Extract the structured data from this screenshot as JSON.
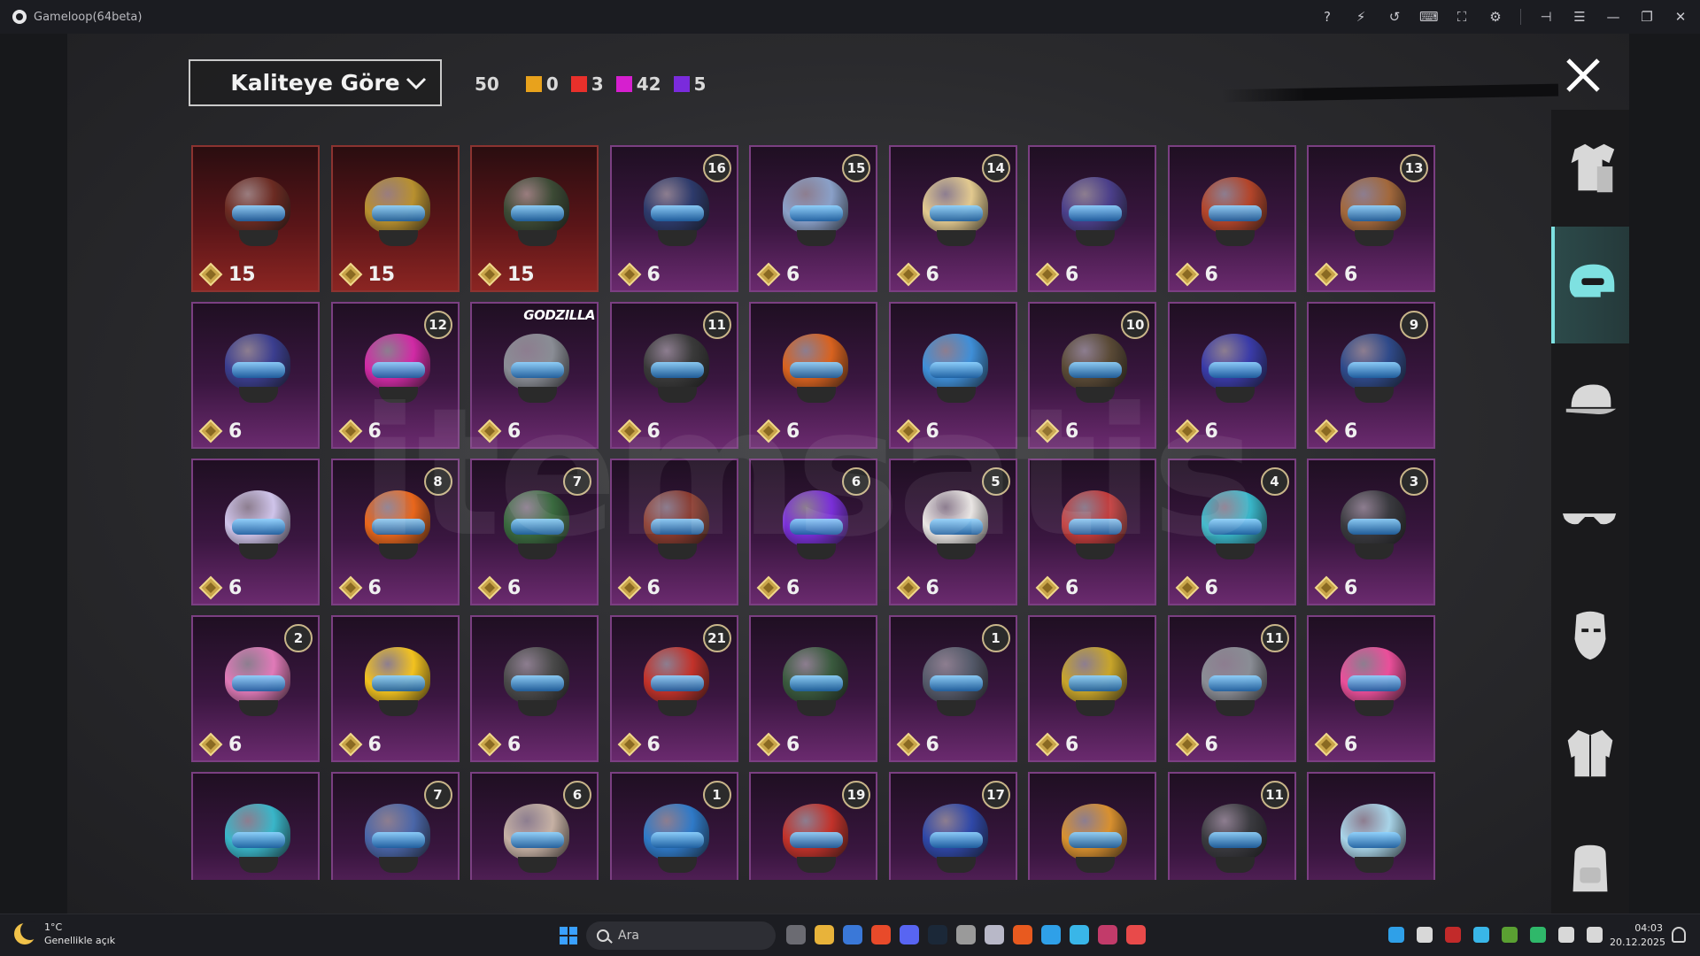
{
  "titlebar": {
    "title": "Gameloop(64beta)",
    "icons": [
      "help-icon",
      "bolt-icon",
      "undo-icon",
      "keyboard-icon",
      "fullscreen-icon",
      "settings-icon",
      "pin-icon",
      "menu-icon",
      "minimize-icon",
      "restore-icon",
      "close-icon"
    ]
  },
  "toolbar": {
    "sort_label": "Kaliteye Göre",
    "total": "50",
    "counts": [
      {
        "color": "#e8a21c",
        "value": "0"
      },
      {
        "color": "#e8302b",
        "value": "3"
      },
      {
        "color": "#d61fcf",
        "value": "42"
      },
      {
        "color": "#7a2bdc",
        "value": "5"
      }
    ]
  },
  "watermark": "itemsatis",
  "items": [
    {
      "price": "15",
      "badge": "",
      "rarity": "red",
      "color": "#6b2b22"
    },
    {
      "price": "15",
      "badge": "",
      "rarity": "red",
      "color": "#b8902f"
    },
    {
      "price": "15",
      "badge": "",
      "rarity": "red",
      "color": "#3c4a35"
    },
    {
      "price": "6",
      "badge": "16",
      "rarity": "purple",
      "color": "#2d3a6b"
    },
    {
      "price": "6",
      "badge": "15",
      "rarity": "purple",
      "color": "#8aa0c8"
    },
    {
      "price": "6",
      "badge": "14",
      "rarity": "purple",
      "color": "#e2c98f"
    },
    {
      "price": "6",
      "badge": "",
      "rarity": "purple",
      "color": "#4b3f8a"
    },
    {
      "price": "6",
      "badge": "",
      "rarity": "purple",
      "color": "#b3452a"
    },
    {
      "price": "6",
      "badge": "13",
      "rarity": "purple",
      "color": "#a2683c"
    },
    {
      "price": "6",
      "badge": "",
      "rarity": "purple",
      "color": "#3b3e8f"
    },
    {
      "price": "6",
      "badge": "12",
      "rarity": "purple",
      "color": "#d12aa5"
    },
    {
      "price": "6",
      "badge": "",
      "rarity": "purple",
      "color": "#8a8d95",
      "tag": "GODZILLA"
    },
    {
      "price": "6",
      "badge": "11",
      "rarity": "purple",
      "color": "#3a3a3a"
    },
    {
      "price": "6",
      "badge": "",
      "rarity": "purple",
      "color": "#d8621f"
    },
    {
      "price": "6",
      "badge": "",
      "rarity": "purple",
      "color": "#3f8fd8"
    },
    {
      "price": "6",
      "badge": "10",
      "rarity": "purple",
      "color": "#5a4a36"
    },
    {
      "price": "6",
      "badge": "",
      "rarity": "purple",
      "color": "#3a3ba8"
    },
    {
      "price": "6",
      "badge": "9",
      "rarity": "purple",
      "color": "#2f4a8a"
    },
    {
      "price": "6",
      "badge": "",
      "rarity": "purple",
      "color": "#cfc4ea"
    },
    {
      "price": "6",
      "badge": "8",
      "rarity": "purple",
      "color": "#e8661c"
    },
    {
      "price": "6",
      "badge": "7",
      "rarity": "purple",
      "color": "#3a6a3f"
    },
    {
      "price": "6",
      "badge": "",
      "rarity": "purple",
      "color": "#8a3b2f"
    },
    {
      "price": "6",
      "badge": "6",
      "rarity": "purple",
      "color": "#7a2fd8"
    },
    {
      "price": "6",
      "badge": "5",
      "rarity": "purple",
      "color": "#e8e4e2"
    },
    {
      "price": "6",
      "badge": "",
      "rarity": "purple",
      "color": "#c23b3b"
    },
    {
      "price": "6",
      "badge": "4",
      "rarity": "purple",
      "color": "#39b6c9"
    },
    {
      "price": "6",
      "badge": "3",
      "rarity": "purple",
      "color": "#3a3a3f"
    },
    {
      "price": "6",
      "badge": "2",
      "rarity": "purple",
      "color": "#e07ab8"
    },
    {
      "price": "6",
      "badge": "",
      "rarity": "purple",
      "color": "#f2c21f"
    },
    {
      "price": "6",
      "badge": "",
      "rarity": "purple",
      "color": "#4a4a4a"
    },
    {
      "price": "6",
      "badge": "21",
      "rarity": "purple",
      "color": "#c2322a"
    },
    {
      "price": "6",
      "badge": "",
      "rarity": "purple",
      "color": "#3a5a3e"
    },
    {
      "price": "6",
      "badge": "1",
      "rarity": "purple",
      "color": "#555a6a"
    },
    {
      "price": "6",
      "badge": "",
      "rarity": "purple",
      "color": "#c8a52a"
    },
    {
      "price": "6",
      "badge": "11",
      "rarity": "purple",
      "color": "#8a8d95"
    },
    {
      "price": "6",
      "badge": "",
      "rarity": "purple",
      "color": "#ea4f9a"
    },
    {
      "price": "",
      "badge": "",
      "rarity": "purple",
      "color": "#39b6c9"
    },
    {
      "price": "",
      "badge": "7",
      "rarity": "purple",
      "color": "#4a66a8"
    },
    {
      "price": "",
      "badge": "6",
      "rarity": "purple",
      "color": "#c6b1a4"
    },
    {
      "price": "",
      "badge": "1",
      "rarity": "purple",
      "color": "#2f7ac8"
    },
    {
      "price": "",
      "badge": "19",
      "rarity": "purple",
      "color": "#c2322a"
    },
    {
      "price": "",
      "badge": "17",
      "rarity": "purple",
      "color": "#2f48a8"
    },
    {
      "price": "",
      "badge": "",
      "rarity": "purple",
      "color": "#d8902f"
    },
    {
      "price": "",
      "badge": "11",
      "rarity": "purple",
      "color": "#3a3a3f"
    },
    {
      "price": "",
      "badge": "",
      "rarity": "purple",
      "color": "#a8d4e8"
    }
  ],
  "rail": [
    {
      "name": "category-outfit",
      "icon": "outfit-icon",
      "active": false
    },
    {
      "name": "category-helmet",
      "icon": "helmet-icon",
      "active": true
    },
    {
      "name": "category-cap",
      "icon": "cap-icon",
      "active": false
    },
    {
      "name": "category-glasses",
      "icon": "glasses-icon",
      "active": false
    },
    {
      "name": "category-mask",
      "icon": "mask-icon",
      "active": false
    },
    {
      "name": "category-jacket",
      "icon": "jacket-icon",
      "active": false
    },
    {
      "name": "category-backpack",
      "icon": "backpack-icon",
      "active": false
    }
  ],
  "taskbar": {
    "temp": "1°C",
    "weather": "Genellikle açık",
    "search_placeholder": "Ara",
    "time": "04:03",
    "date": "20.12.2025",
    "apps": [
      "#6b6b72",
      "#e8b33a",
      "#3a78d8",
      "#e84a2a",
      "#5865f2",
      "#1b2838",
      "#9a9a9a",
      "#b8b8c8",
      "#e85a1f",
      "#2fa0e8",
      "#39b6e8",
      "#c23b6a",
      "#e84a4a"
    ],
    "tray": [
      "#2fa0e8",
      "#d8d8d8",
      "#c22a2a",
      "#39b6e8",
      "#5aa032",
      "#2fb86a",
      "#d8d8d8",
      "#d8d8d8"
    ]
  }
}
